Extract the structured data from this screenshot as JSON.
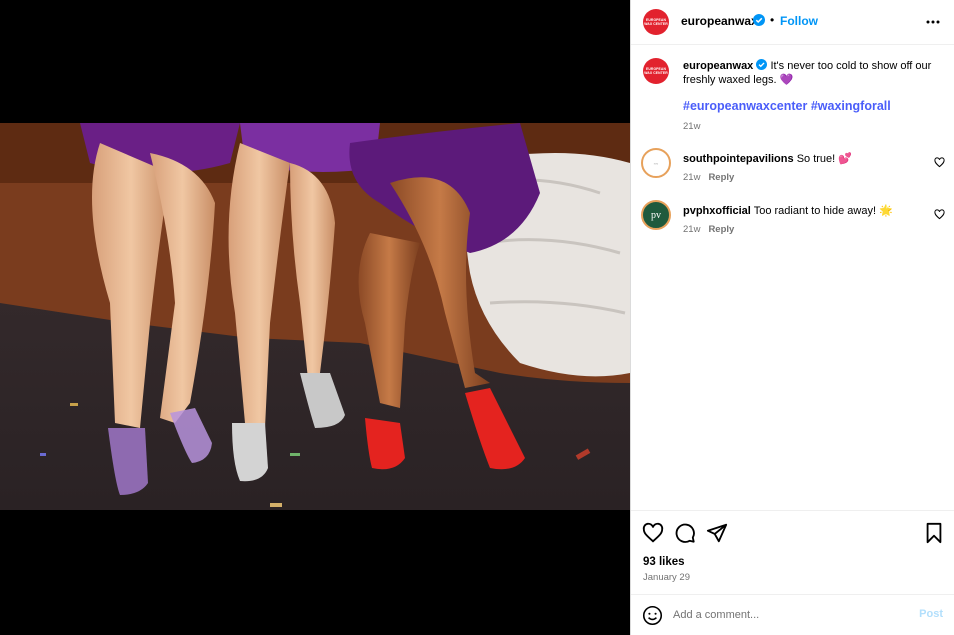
{
  "post": {
    "author": "europeanwax",
    "avatar_text": "EUROPEAN WAX CENTER",
    "follow_label": "Follow",
    "separator": "•",
    "caption": "It's never too cold to show off our freshly waxed legs. 💜",
    "hashtags": [
      "#europeanwaxcenter",
      "#waxingforall"
    ],
    "caption_age": "21w",
    "likes": "93 likes",
    "date": "January 29"
  },
  "comments": [
    {
      "username": "southpointepavilions",
      "text": "So true! 💕",
      "age": "21w",
      "reply_label": "Reply",
      "avatar_color": "#ffffff"
    },
    {
      "username": "pvphxofficial",
      "text": "Too radiant to hide away! 🌟",
      "age": "21w",
      "reply_label": "Reply",
      "avatar_color": "#1f5a3d",
      "avatar_text": "pv"
    }
  ],
  "comment_box": {
    "placeholder": "Add a comment...",
    "post_label": "Post"
  },
  "colors": {
    "accent": "#0095f6",
    "brand": "#e2222e",
    "hashtag": "#4a5df9"
  }
}
